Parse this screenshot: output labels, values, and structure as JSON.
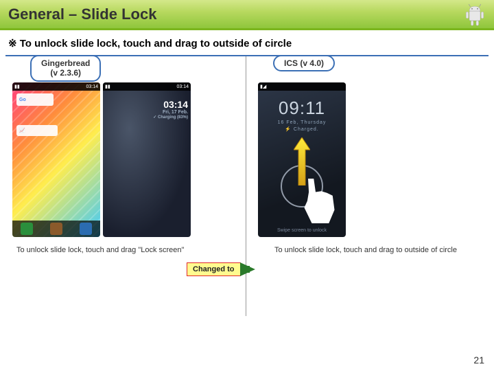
{
  "header": {
    "title": "General – Slide Lock"
  },
  "subtitle": "※ To unlock slide lock, touch and drag to outside of circle",
  "versions": {
    "left": {
      "name": "Gingerbread",
      "ver": "(v 2.3.6)"
    },
    "right": {
      "name": "ICS (v 4.0)"
    }
  },
  "phones": {
    "home": {
      "time": "03:14",
      "g": "Go"
    },
    "lock": {
      "time": "03:14",
      "date": "Fri, 17 Feb.",
      "charging": "✓ Charging (83%)"
    },
    "ics": {
      "time": "09:11",
      "date": "16 Feb, Thursday",
      "charging": "⚡ Charged.",
      "swipe": "Swipe screen to unlock"
    }
  },
  "captions": {
    "left": "To unlock slide lock, touch and drag \"Lock screen\"",
    "right": "To unlock slide lock, touch and drag to outside of circle"
  },
  "changed_label": "Changed to",
  "page_number": "21"
}
